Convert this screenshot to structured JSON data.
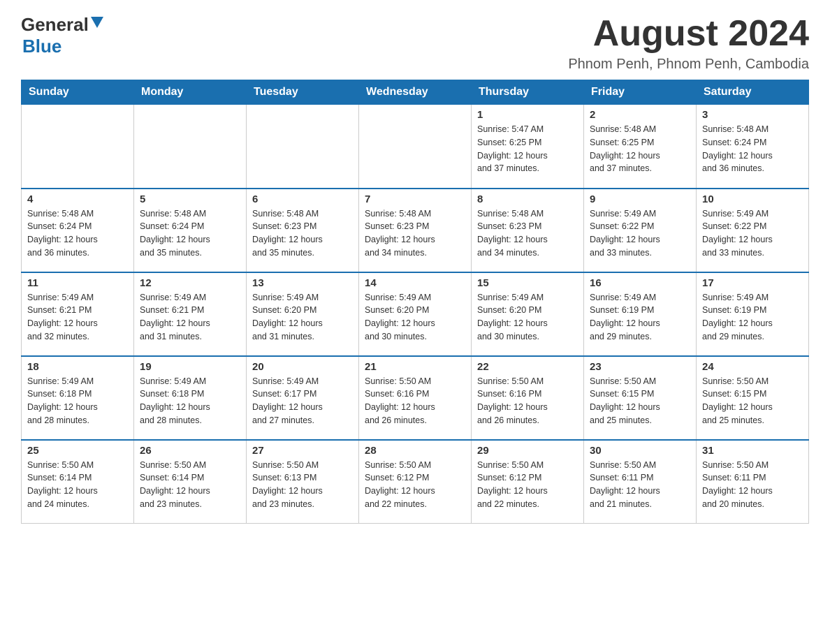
{
  "header": {
    "logo_general": "General",
    "logo_blue": "Blue",
    "month_year": "August 2024",
    "location": "Phnom Penh, Phnom Penh, Cambodia"
  },
  "days_of_week": [
    "Sunday",
    "Monday",
    "Tuesday",
    "Wednesday",
    "Thursday",
    "Friday",
    "Saturday"
  ],
  "weeks": [
    {
      "days": [
        {
          "number": "",
          "info": ""
        },
        {
          "number": "",
          "info": ""
        },
        {
          "number": "",
          "info": ""
        },
        {
          "number": "",
          "info": ""
        },
        {
          "number": "1",
          "info": "Sunrise: 5:47 AM\nSunset: 6:25 PM\nDaylight: 12 hours\nand 37 minutes."
        },
        {
          "number": "2",
          "info": "Sunrise: 5:48 AM\nSunset: 6:25 PM\nDaylight: 12 hours\nand 37 minutes."
        },
        {
          "number": "3",
          "info": "Sunrise: 5:48 AM\nSunset: 6:24 PM\nDaylight: 12 hours\nand 36 minutes."
        }
      ]
    },
    {
      "days": [
        {
          "number": "4",
          "info": "Sunrise: 5:48 AM\nSunset: 6:24 PM\nDaylight: 12 hours\nand 36 minutes."
        },
        {
          "number": "5",
          "info": "Sunrise: 5:48 AM\nSunset: 6:24 PM\nDaylight: 12 hours\nand 35 minutes."
        },
        {
          "number": "6",
          "info": "Sunrise: 5:48 AM\nSunset: 6:23 PM\nDaylight: 12 hours\nand 35 minutes."
        },
        {
          "number": "7",
          "info": "Sunrise: 5:48 AM\nSunset: 6:23 PM\nDaylight: 12 hours\nand 34 minutes."
        },
        {
          "number": "8",
          "info": "Sunrise: 5:48 AM\nSunset: 6:23 PM\nDaylight: 12 hours\nand 34 minutes."
        },
        {
          "number": "9",
          "info": "Sunrise: 5:49 AM\nSunset: 6:22 PM\nDaylight: 12 hours\nand 33 minutes."
        },
        {
          "number": "10",
          "info": "Sunrise: 5:49 AM\nSunset: 6:22 PM\nDaylight: 12 hours\nand 33 minutes."
        }
      ]
    },
    {
      "days": [
        {
          "number": "11",
          "info": "Sunrise: 5:49 AM\nSunset: 6:21 PM\nDaylight: 12 hours\nand 32 minutes."
        },
        {
          "number": "12",
          "info": "Sunrise: 5:49 AM\nSunset: 6:21 PM\nDaylight: 12 hours\nand 31 minutes."
        },
        {
          "number": "13",
          "info": "Sunrise: 5:49 AM\nSunset: 6:20 PM\nDaylight: 12 hours\nand 31 minutes."
        },
        {
          "number": "14",
          "info": "Sunrise: 5:49 AM\nSunset: 6:20 PM\nDaylight: 12 hours\nand 30 minutes."
        },
        {
          "number": "15",
          "info": "Sunrise: 5:49 AM\nSunset: 6:20 PM\nDaylight: 12 hours\nand 30 minutes."
        },
        {
          "number": "16",
          "info": "Sunrise: 5:49 AM\nSunset: 6:19 PM\nDaylight: 12 hours\nand 29 minutes."
        },
        {
          "number": "17",
          "info": "Sunrise: 5:49 AM\nSunset: 6:19 PM\nDaylight: 12 hours\nand 29 minutes."
        }
      ]
    },
    {
      "days": [
        {
          "number": "18",
          "info": "Sunrise: 5:49 AM\nSunset: 6:18 PM\nDaylight: 12 hours\nand 28 minutes."
        },
        {
          "number": "19",
          "info": "Sunrise: 5:49 AM\nSunset: 6:18 PM\nDaylight: 12 hours\nand 28 minutes."
        },
        {
          "number": "20",
          "info": "Sunrise: 5:49 AM\nSunset: 6:17 PM\nDaylight: 12 hours\nand 27 minutes."
        },
        {
          "number": "21",
          "info": "Sunrise: 5:50 AM\nSunset: 6:16 PM\nDaylight: 12 hours\nand 26 minutes."
        },
        {
          "number": "22",
          "info": "Sunrise: 5:50 AM\nSunset: 6:16 PM\nDaylight: 12 hours\nand 26 minutes."
        },
        {
          "number": "23",
          "info": "Sunrise: 5:50 AM\nSunset: 6:15 PM\nDaylight: 12 hours\nand 25 minutes."
        },
        {
          "number": "24",
          "info": "Sunrise: 5:50 AM\nSunset: 6:15 PM\nDaylight: 12 hours\nand 25 minutes."
        }
      ]
    },
    {
      "days": [
        {
          "number": "25",
          "info": "Sunrise: 5:50 AM\nSunset: 6:14 PM\nDaylight: 12 hours\nand 24 minutes."
        },
        {
          "number": "26",
          "info": "Sunrise: 5:50 AM\nSunset: 6:14 PM\nDaylight: 12 hours\nand 23 minutes."
        },
        {
          "number": "27",
          "info": "Sunrise: 5:50 AM\nSunset: 6:13 PM\nDaylight: 12 hours\nand 23 minutes."
        },
        {
          "number": "28",
          "info": "Sunrise: 5:50 AM\nSunset: 6:12 PM\nDaylight: 12 hours\nand 22 minutes."
        },
        {
          "number": "29",
          "info": "Sunrise: 5:50 AM\nSunset: 6:12 PM\nDaylight: 12 hours\nand 22 minutes."
        },
        {
          "number": "30",
          "info": "Sunrise: 5:50 AM\nSunset: 6:11 PM\nDaylight: 12 hours\nand 21 minutes."
        },
        {
          "number": "31",
          "info": "Sunrise: 5:50 AM\nSunset: 6:11 PM\nDaylight: 12 hours\nand 20 minutes."
        }
      ]
    }
  ]
}
